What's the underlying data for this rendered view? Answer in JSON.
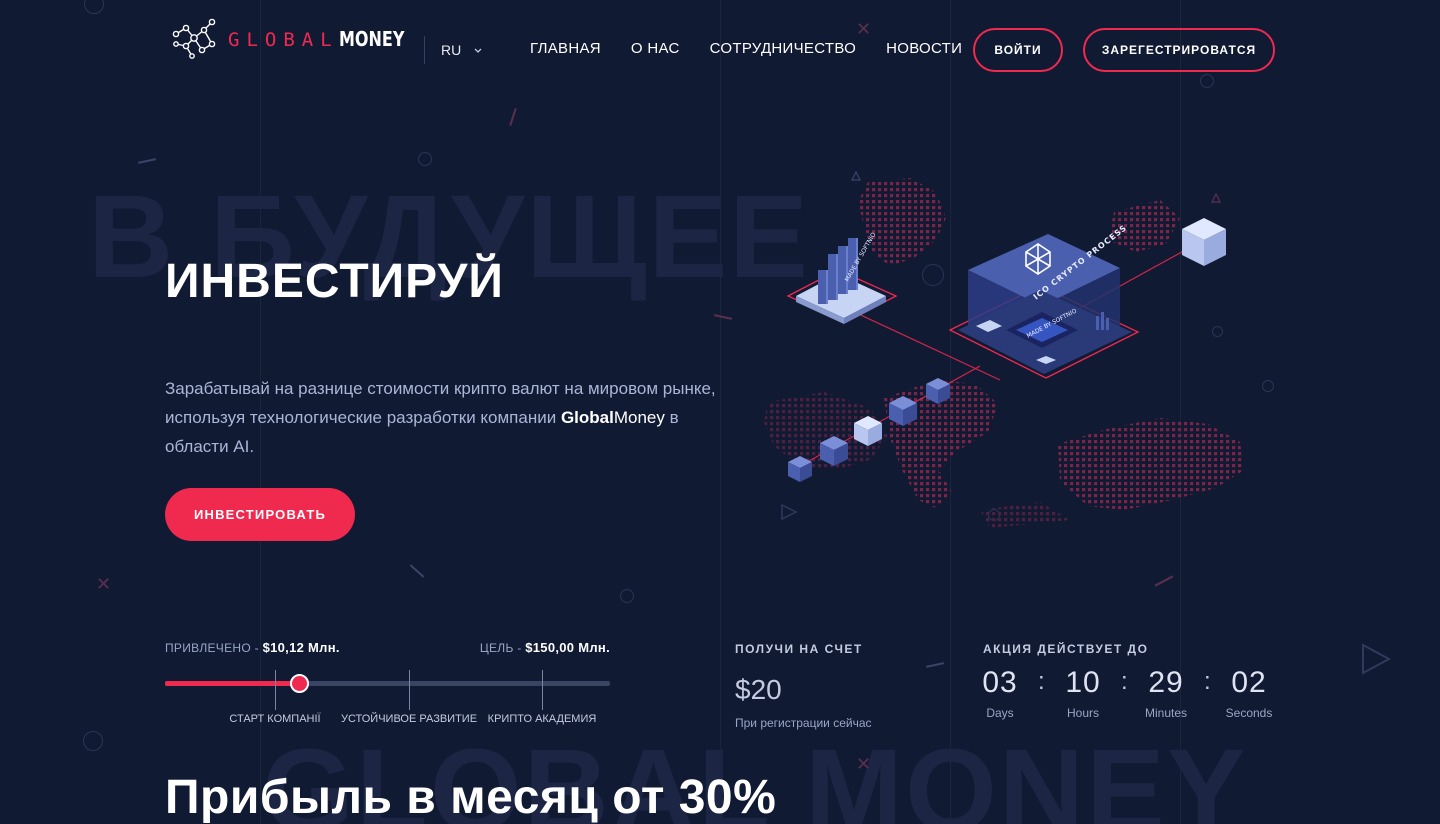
{
  "background": {
    "top_word": "В БУДУЩЕЕ",
    "bottom_word": "GLOBAL MONEY"
  },
  "colors": {
    "background": "#111a33",
    "accent": "#f0294f",
    "muted_text": "#aab6d6"
  },
  "header": {
    "logo_global": "GLOBAL",
    "logo_money": "MONEY",
    "language": "RU",
    "nav": [
      "ГЛАВНАЯ",
      "О НАС",
      "СОТРУДНИЧЕСТВО",
      "НОВОСТИ"
    ],
    "login_label": "ВОЙТИ",
    "register_label": "ЗАРЕГЕСТРИРОВАТСЯ"
  },
  "hero": {
    "title": "ИНВЕСТИРУЙ",
    "text_part1": "Зарабатывай на разнице стоимости крипто валют на мировом рынке, используя технологические разработки компании ",
    "brand_bold": "Global",
    "brand_light": "Money",
    "text_part2": " в области AI.",
    "cta_label": "ИНВЕСТИРОВАТЬ"
  },
  "illustration": {
    "platform_label": "ICO CRYPTO PROCESS",
    "chip_label": "MADE BY SOFTNIO",
    "bar_label": "MADE BY SOFTNIO"
  },
  "progress": {
    "raised_label": "ПРИВЛЕЧЕНО - ",
    "raised_value": "$10,12 Млн.",
    "goal_label": "ЦЕЛЬ - ",
    "goal_value": "$150,00 Млн.",
    "fill_fraction": 0.3,
    "milestones": [
      "СТАРТ КОМПАНІЇ",
      "УСТОЙЧИВОЕ РАЗВИТИЕ",
      "КРИПТО АКАДЕМИЯ"
    ]
  },
  "bonus": {
    "heading": "ПОЛУЧИ НА СЧЕТ",
    "amount": "$20",
    "subtitle": "При регистрации сейчас"
  },
  "promo": {
    "heading": "АКЦИЯ ДЕЙСТВУЕТ ДО",
    "units": [
      {
        "value": "03",
        "label": "Days"
      },
      {
        "value": "10",
        "label": "Hours"
      },
      {
        "value": "29",
        "label": "Minutes"
      },
      {
        "value": "02",
        "label": "Seconds"
      }
    ],
    "separator": ":"
  },
  "profit": {
    "title": "Прибыль в месяц от 30%"
  }
}
